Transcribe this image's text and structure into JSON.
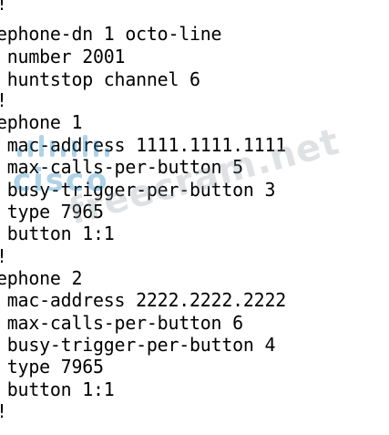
{
  "config": {
    "lines": [
      "!",
      "ephone-dn 1 octo-line",
      " number 2001",
      " huntstop channel 6",
      "!",
      "ephone 1",
      " mac-address 1111.1111.1111",
      " max-calls-per-button 5",
      " busy-trigger-per-button 3",
      " type 7965",
      " button 1:1",
      "!",
      "ephone 2",
      " mac-address 2222.2222.2222",
      " max-calls-per-button 6",
      " busy-trigger-per-button 4",
      " type 7965",
      " button 1:1",
      "!"
    ]
  },
  "watermarks": {
    "logo_text": "cisco",
    "site_text": "freecram.net"
  }
}
